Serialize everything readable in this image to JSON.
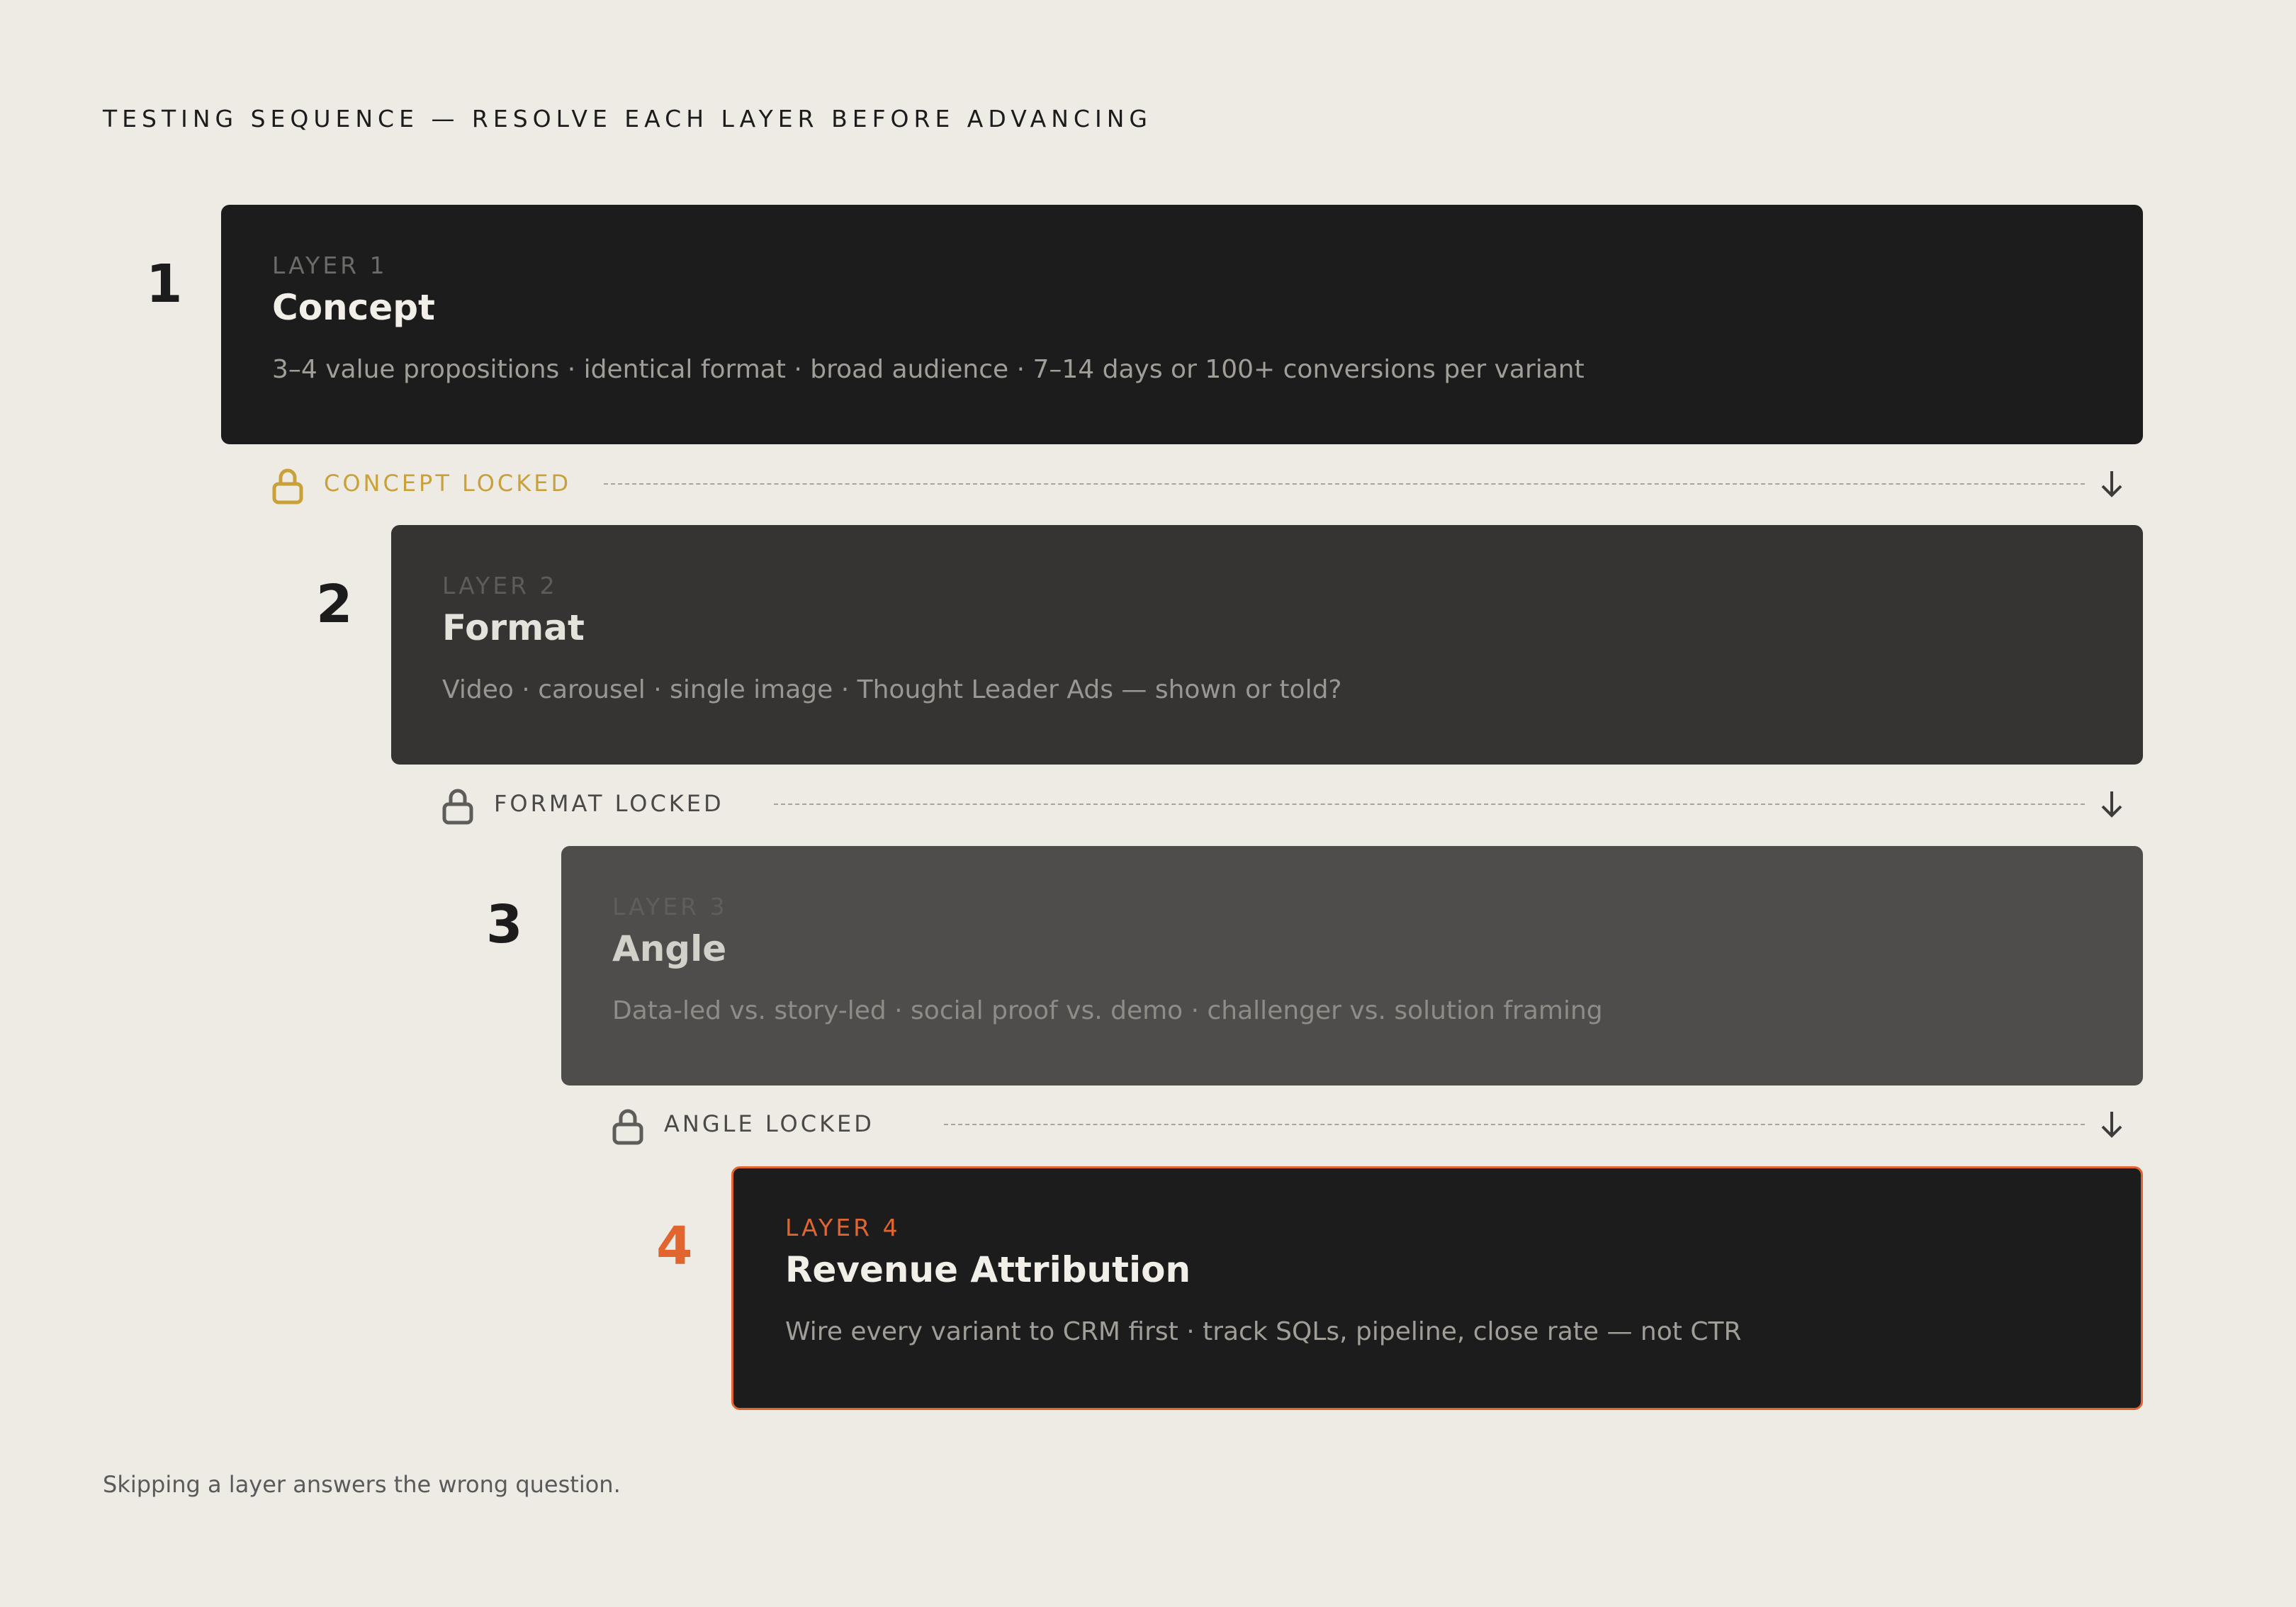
{
  "heading": "TESTING SEQUENCE — RESOLVE EACH LAYER BEFORE ADVANCING",
  "layers": [
    {
      "number": "1",
      "kicker": "LAYER 1",
      "title": "Concept",
      "description": "3–4 value propositions · identical format · broad audience · 7–14 days or 100+ conversions per variant",
      "lock_label": "CONCEPT LOCKED"
    },
    {
      "number": "2",
      "kicker": "LAYER 2",
      "title": "Format",
      "description": "Video · carousel · single image · Thought Leader Ads — shown or told?",
      "lock_label": "FORMAT LOCKED"
    },
    {
      "number": "3",
      "kicker": "LAYER 3",
      "title": "Angle",
      "description": "Data-led vs. story-led · social proof vs. demo · challenger vs. solution framing",
      "lock_label": "ANGLE LOCKED"
    },
    {
      "number": "4",
      "kicker": "LAYER 4",
      "title": "Revenue Attribution",
      "description": "Wire every variant to CRM first · track SQLs, pipeline, close rate — not CTR"
    }
  ],
  "footer": "Skipping a layer answers the wrong question.",
  "colors": {
    "background": "#eeebe5",
    "accent_gold": "#c9a13a",
    "accent_orange": "#e0652f",
    "card_1": "#1c1c1c",
    "card_2": "#353433",
    "card_3": "#4e4d4b",
    "card_4": "#1c1c1c"
  },
  "icons": {
    "lock": "lock-icon",
    "arrow": "arrow-down-icon"
  }
}
